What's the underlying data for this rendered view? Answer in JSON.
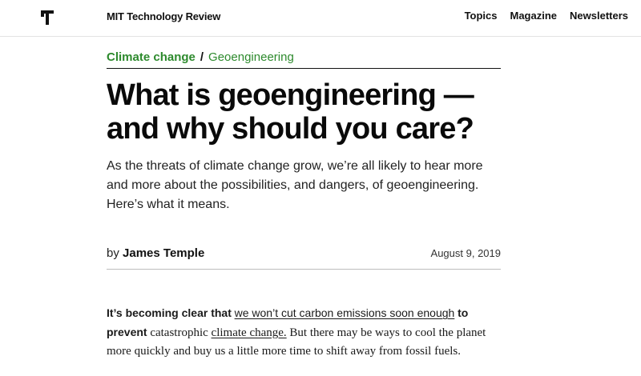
{
  "header": {
    "logo_icon": "mit-tr-logo-icon",
    "brand": "MIT Technology Review",
    "nav": [
      {
        "label": "Topics"
      },
      {
        "label": "Magazine"
      },
      {
        "label": "Newsletters"
      }
    ]
  },
  "breadcrumb": {
    "primary": "Climate change",
    "separator": "/",
    "secondary": "Geoengineering"
  },
  "article": {
    "title": "What is geoengineering — and why should you care?",
    "dek": "As the threats of climate change grow, we’re all likely to hear more and more about the possibilities, and dangers, of geoengineering. Here’s what it means.",
    "byline_prefix": "by",
    "author": "James Temple",
    "date": "August 9, 2019",
    "body": {
      "lead": "It’s becoming clear that",
      "link1": "we won’t cut carbon emissions soon enough",
      "lead_end": "to prevent",
      "text1": "catastrophic",
      "link2": "climate change.",
      "text2": "But there may be ways to cool the planet more quickly and buy us a little more time to shift away from fossil fuels."
    }
  },
  "colors": {
    "accent_green": "#2d8a2d",
    "text": "#111111"
  }
}
